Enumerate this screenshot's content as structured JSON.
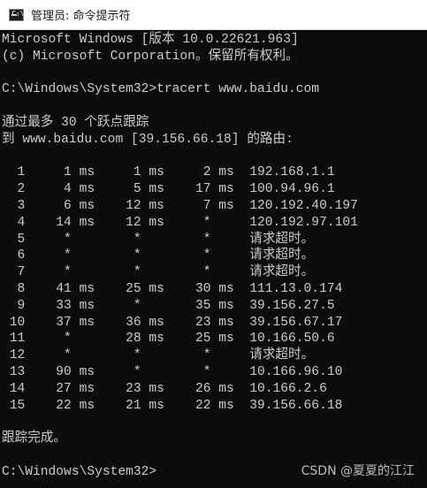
{
  "window": {
    "title": "管理员: 命令提示符",
    "icon": "cmd-icon"
  },
  "console": {
    "lines": [
      "Microsoft Windows [版本 10.0.22621.963]",
      "(c) Microsoft Corporation。保留所有权利。",
      "",
      "C:\\Windows\\System32>tracert www.baidu.com",
      "",
      "通过最多 30 个跃点跟踪",
      "到 www.baidu.com [39.156.66.18] 的路由:",
      "",
      "  1     1 ms     1 ms     2 ms  192.168.1.1",
      "  2     4 ms     5 ms    17 ms  100.94.96.1",
      "  3     6 ms    12 ms     7 ms  120.192.40.197",
      "  4    14 ms    12 ms     *     120.192.97.101",
      "  5     *        *        *     请求超时。",
      "  6     *        *        *     请求超时。",
      "  7     *        *        *     请求超时。",
      "  8    41 ms    25 ms    30 ms  111.13.0.174",
      "  9    33 ms     *       35 ms  39.156.27.5",
      " 10    37 ms    36 ms    23 ms  39.156.67.17",
      " 11     *       28 ms    25 ms  10.166.50.6",
      " 12     *        *        *     请求超时。",
      " 13    90 ms     *        *     10.166.96.10",
      " 14    27 ms    23 ms    26 ms  10.166.2.6",
      " 15    22 ms    21 ms    22 ms  39.156.66.18",
      "",
      "跟踪完成。",
      "",
      "C:\\Windows\\System32>"
    ]
  },
  "watermark": "CSDN @夏夏的江江"
}
